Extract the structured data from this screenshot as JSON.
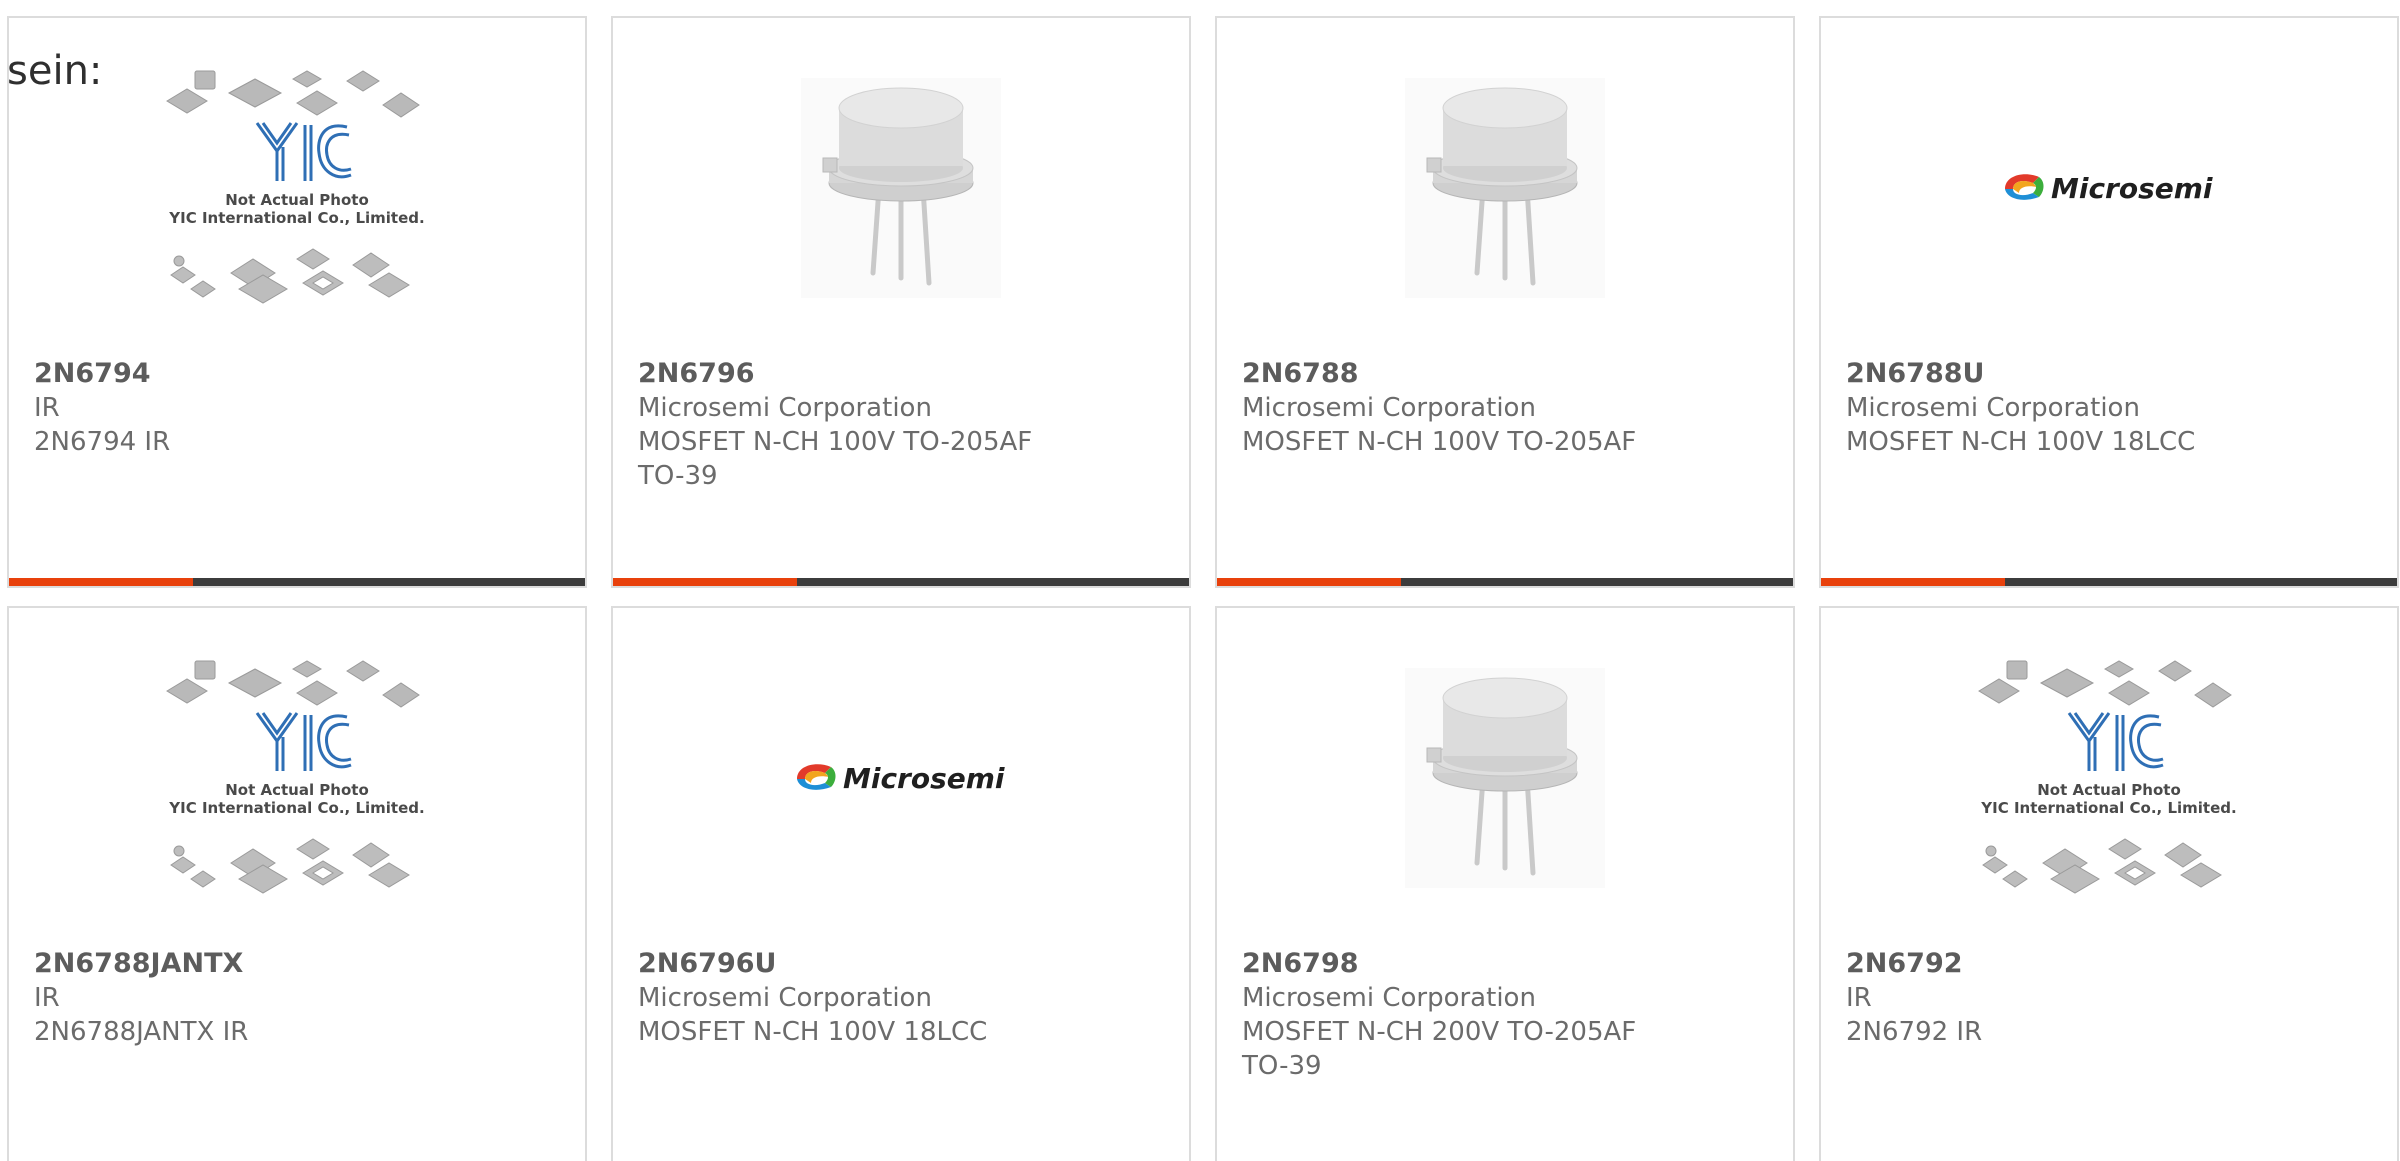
{
  "intro_text": "sein:",
  "colors": {
    "accent": "#e8410c",
    "bar_track": "#3c3c3c",
    "border": "#dcdcdc",
    "text": "#6b6b6b"
  },
  "placeholder_image_text": {
    "line1": "Not Actual Photo",
    "line2": "YIC International Co., Limited.",
    "logo": "YIC"
  },
  "microsemi_logo_text": "Microsemi",
  "cards": [
    {
      "part_number": "2N6794",
      "manufacturer": "IR",
      "description": "2N6794 IR",
      "package": "",
      "image_type": "yic-placeholder",
      "progress_fraction": 0.32
    },
    {
      "part_number": "2N6796",
      "manufacturer": "Microsemi Corporation",
      "description": "MOSFET N-CH 100V TO-205AF",
      "package": "TO-39",
      "image_type": "to39-transistor",
      "progress_fraction": 0.32
    },
    {
      "part_number": "2N6788",
      "manufacturer": "Microsemi Corporation",
      "description": "MOSFET N-CH 100V TO-205AF",
      "package": "",
      "image_type": "to39-transistor",
      "progress_fraction": 0.32
    },
    {
      "part_number": "2N6788U",
      "manufacturer": "Microsemi Corporation",
      "description": "MOSFET N-CH 100V 18LCC",
      "package": "",
      "image_type": "microsemi-logo",
      "progress_fraction": 0.32
    },
    {
      "part_number": "2N6788JANTX",
      "manufacturer": "IR",
      "description": "2N6788JANTX IR",
      "package": "",
      "image_type": "yic-placeholder",
      "progress_fraction": null
    },
    {
      "part_number": "2N6796U",
      "manufacturer": "Microsemi Corporation",
      "description": "MOSFET N-CH 100V 18LCC",
      "package": "",
      "image_type": "microsemi-logo",
      "progress_fraction": null
    },
    {
      "part_number": "2N6798",
      "manufacturer": "Microsemi Corporation",
      "description": "MOSFET N-CH 200V TO-205AF",
      "package": "TO-39",
      "image_type": "to39-transistor",
      "progress_fraction": null
    },
    {
      "part_number": "2N6792",
      "manufacturer": "IR",
      "description": "2N6792 IR",
      "package": "",
      "image_type": "yic-placeholder",
      "progress_fraction": null
    }
  ]
}
